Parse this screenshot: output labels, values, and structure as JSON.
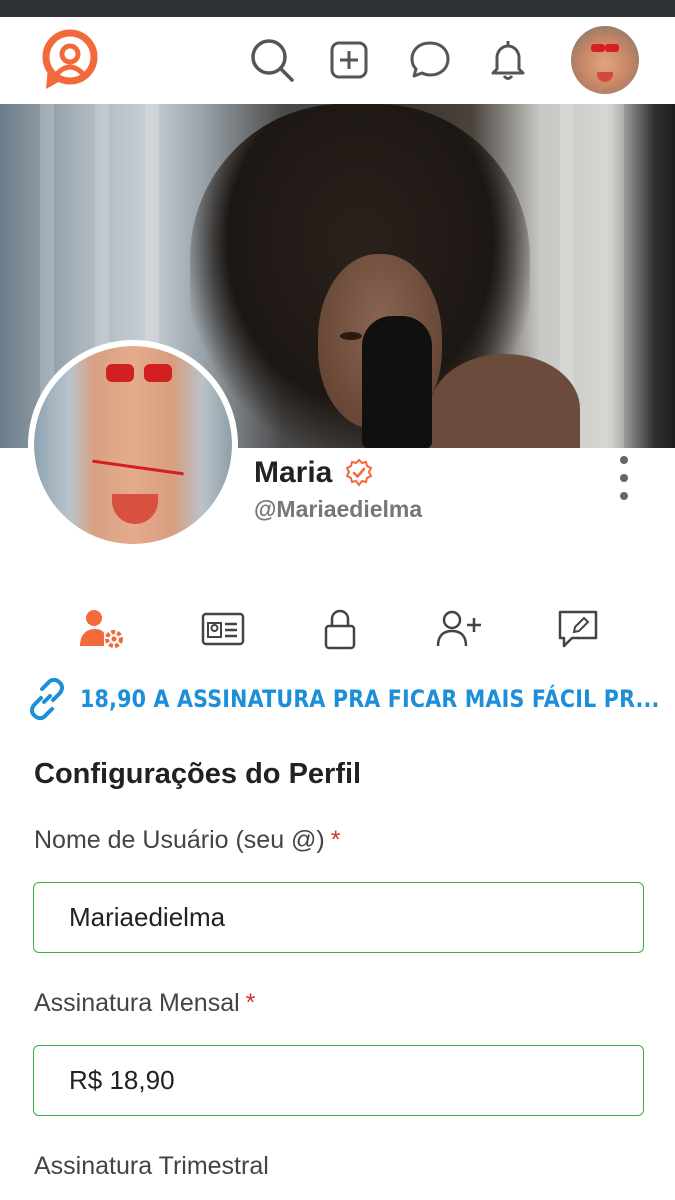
{
  "nav": {
    "icons": [
      "logo-icon",
      "search-icon",
      "add-post-icon",
      "chat-icon",
      "bell-icon",
      "avatar"
    ]
  },
  "profile": {
    "name": "Maria",
    "handle": "@Mariaedielma",
    "verified": true
  },
  "tabs": [
    "settings-user-icon",
    "id-card-icon",
    "lock-icon",
    "add-user-icon",
    "edit-note-icon"
  ],
  "link": {
    "text": "18,90 A ASSINATURA PRA FICAR MAIS FÁCIL PR..."
  },
  "settings": {
    "title": "Configurações do Perfil",
    "username_label": "Nome de Usuário (seu @)",
    "username_value": "Mariaedielma",
    "monthly_label": "Assinatura Mensal",
    "monthly_value": "R$ 18,90",
    "quarterly_label": "Assinatura Trimestral",
    "required_mark": "*"
  },
  "colors": {
    "brand": "#f26a3b",
    "link": "#1c8fd8",
    "field_border": "#3fae3f",
    "required": "#d0342c",
    "verified": "#f26a3b"
  }
}
